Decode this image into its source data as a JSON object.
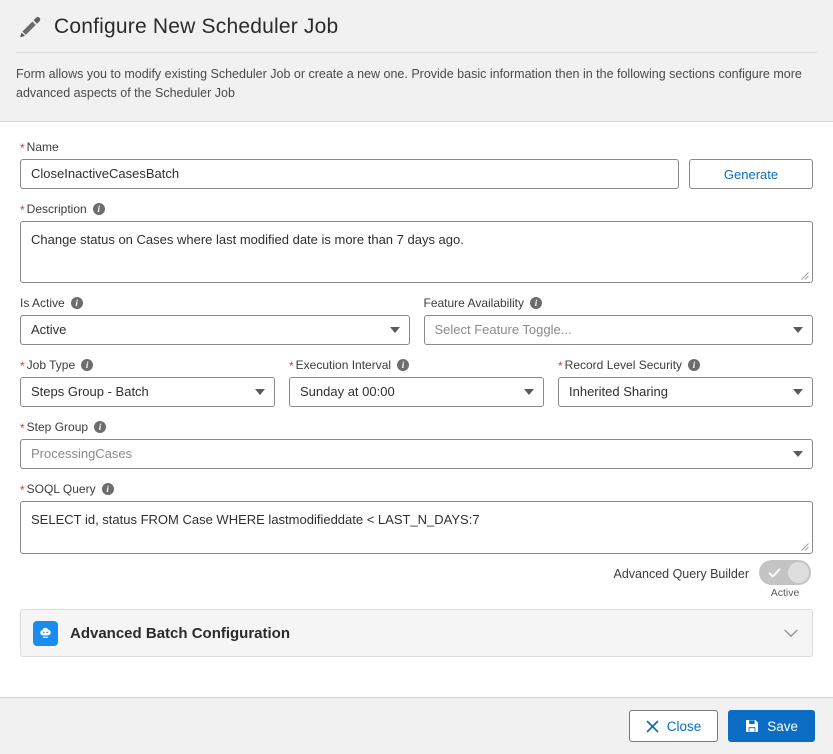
{
  "header": {
    "title": "Configure New Scheduler Job",
    "icon": "pencil-icon",
    "description": "Form allows you to modify existing Scheduler Job or create a new one. Provide basic information then in the following sections configure more advanced aspects of the Scheduler Job"
  },
  "form": {
    "name": {
      "label": "Name",
      "required": true,
      "value": "CloseInactiveCasesBatch",
      "generate_label": "Generate"
    },
    "description": {
      "label": "Description",
      "required": true,
      "value": "Change status on Cases where last modified date is more than 7 days ago."
    },
    "is_active": {
      "label": "Is Active",
      "required": false,
      "value": "Active"
    },
    "feature_availability": {
      "label": "Feature Availability",
      "required": false,
      "placeholder": "Select Feature Toggle..."
    },
    "job_type": {
      "label": "Job Type",
      "required": true,
      "value": "Steps Group - Batch"
    },
    "execution_interval": {
      "label": "Execution Interval",
      "required": true,
      "value": "Sunday at 00:00"
    },
    "record_level_security": {
      "label": "Record Level Security",
      "required": true,
      "value": "Inherited Sharing"
    },
    "step_group": {
      "label": "Step Group",
      "required": true,
      "value": "ProcessingCases"
    },
    "soql_query": {
      "label": "SOQL Query",
      "required": true,
      "value": "SELECT id, status FROM Case WHERE lastmodifieddate < LAST_N_DAYS:7"
    },
    "advanced_query_builder": {
      "label": "Advanced Query Builder",
      "state_caption": "Active",
      "checked": true
    }
  },
  "sections": [
    {
      "title": "Advanced Batch Configuration",
      "icon": "batch-apex-icon",
      "chevron": "chevron-down-icon",
      "expanded": false
    }
  ],
  "footer": {
    "close_label": "Close",
    "save_label": "Save"
  },
  "colors": {
    "accent_blue": "#0b6cc4",
    "link_blue": "#0a6ebd",
    "section_icon_blue": "#1a8cf0",
    "required_red": "#d13b3b",
    "header_bg": "#f1f1f1",
    "toggle_gray": "#c4c4c4"
  }
}
